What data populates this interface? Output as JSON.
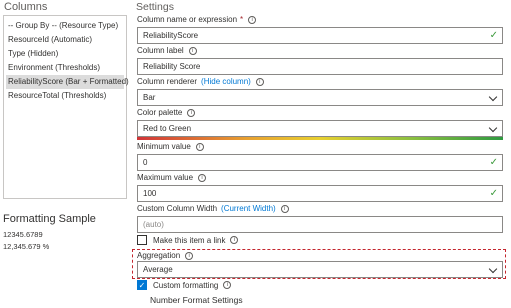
{
  "left": {
    "columns_heading": "Columns",
    "columns": [
      {
        "label": "-- Group By -- (Resource Type)",
        "selected": false
      },
      {
        "label": "ResourceId (Automatic)",
        "selected": false
      },
      {
        "label": "Type (Hidden)",
        "selected": false
      },
      {
        "label": "Environment (Thresholds)",
        "selected": false
      },
      {
        "label": "ReliabilityScore (Bar + Formatted)",
        "selected": true
      },
      {
        "label": "ResourceTotal (Thresholds)",
        "selected": false
      }
    ],
    "formatting_sample_title": "Formatting Sample",
    "formatting_sample_values": [
      "12345.6789",
      "12,345.679 %"
    ]
  },
  "settings": {
    "heading": "Settings",
    "column_name_label": "Column name or expression",
    "column_name_required": "*",
    "column_name_value": "ReliabilityScore",
    "column_label_label": "Column label",
    "column_label_value": "Reliability Score",
    "column_renderer_label": "Column renderer",
    "hide_column_link": "(Hide column)",
    "column_renderer_value": "Bar",
    "color_palette_label": "Color palette",
    "color_palette_value": "Red to Green",
    "min_value_label": "Minimum value",
    "min_value": "0",
    "max_value_label": "Maximum value",
    "max_value": "100",
    "custom_width_label": "Custom Column Width",
    "current_width_link": "(Current Width)",
    "custom_width_placeholder": "(auto)",
    "make_link_label": "Make this item a link",
    "make_link_checked": false,
    "aggregation_label": "Aggregation",
    "aggregation_value": "Average",
    "custom_formatting_label": "Custom formatting",
    "custom_formatting_checked": true,
    "number_format_heading": "Number Format Settings",
    "info_glyph": "i",
    "check_glyph": "✓"
  },
  "colors": {
    "accent": "#0078d4",
    "valid_check": "#3c9a3c",
    "highlight_border": "#c4262e",
    "selected_row": "#dcdcdc"
  }
}
